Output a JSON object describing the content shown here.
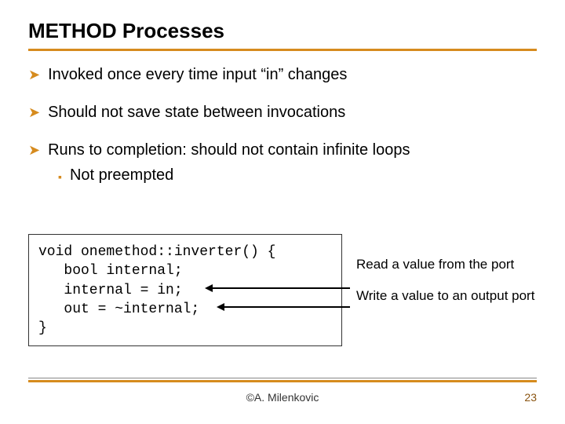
{
  "title": "METHOD Processes",
  "bullets": {
    "b1": "Invoked once every time input “in” changes",
    "b2": "Should not save state between invocations",
    "b3": "Runs to completion: should not contain infinite loops",
    "sub1": "Not preempted"
  },
  "code": {
    "l1": "void onemethod::inverter() {",
    "l2": "   bool internal;",
    "l3": "   internal = in;",
    "l4": "   out = ~internal;",
    "l5": "}"
  },
  "annot": {
    "a1": "Read a value from the port",
    "a2": "Write a value to an output port"
  },
  "footer": {
    "author": "©A. Milenkovic",
    "page": "23"
  }
}
